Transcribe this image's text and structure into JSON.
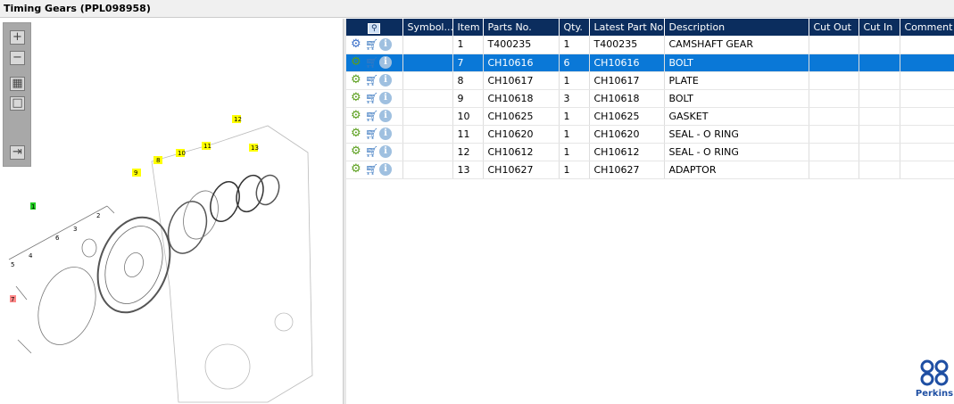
{
  "window": {
    "title": "Timing Gears (PPL098958)"
  },
  "toolbar": {
    "zoom_in": "zoom-in",
    "zoom_out": "zoom-out",
    "fit": "fit-all",
    "actual": "actual-size",
    "export": "export"
  },
  "diagram": {
    "callouts": [
      "12",
      "13",
      "11",
      "10",
      "8",
      "9",
      "1",
      "3",
      "6",
      "2",
      "4",
      "5",
      "7"
    ]
  },
  "grid": {
    "columns": [
      "",
      "Symbol...",
      "Item",
      "Parts No.",
      "Qty.",
      "Latest Part No.",
      "Description",
      "Cut Out",
      "Cut In",
      "Comment"
    ],
    "rows": [
      {
        "item": "1",
        "part": "T400235",
        "qty": "1",
        "latest": "T400235",
        "desc": "CAMSHAFT GEAR"
      },
      {
        "item": "7",
        "part": "CH10616",
        "qty": "6",
        "latest": "CH10616",
        "desc": "BOLT"
      },
      {
        "item": "8",
        "part": "CH10617",
        "qty": "1",
        "latest": "CH10617",
        "desc": "PLATE"
      },
      {
        "item": "9",
        "part": "CH10618",
        "qty": "3",
        "latest": "CH10618",
        "desc": "BOLT"
      },
      {
        "item": "10",
        "part": "CH10625",
        "qty": "1",
        "latest": "CH10625",
        "desc": "GASKET"
      },
      {
        "item": "11",
        "part": "CH10620",
        "qty": "1",
        "latest": "CH10620",
        "desc": "SEAL - O RING"
      },
      {
        "item": "12",
        "part": "CH10612",
        "qty": "1",
        "latest": "CH10612",
        "desc": "SEAL - O RING"
      },
      {
        "item": "13",
        "part": "CH10627",
        "qty": "1",
        "latest": "CH10627",
        "desc": "ADAPTOR"
      }
    ],
    "selected_item": "7"
  },
  "logo": {
    "text": "Perkins"
  },
  "colors": {
    "header": "#0b2d5e",
    "selected": "#0a78d7"
  }
}
